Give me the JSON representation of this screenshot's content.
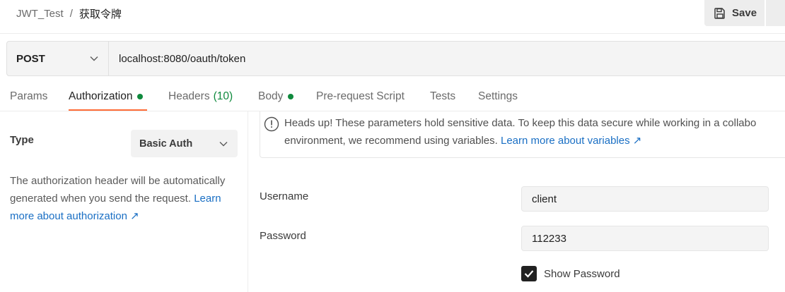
{
  "breadcrumb": {
    "collection": "JWT_Test",
    "separator": "/",
    "request": "获取令牌"
  },
  "toolbar": {
    "save_label": "Save"
  },
  "request": {
    "method": "POST",
    "url": "localhost:8080/oauth/token"
  },
  "tabs": [
    {
      "label": "Params"
    },
    {
      "label": "Authorization",
      "active": true,
      "dot": true
    },
    {
      "label": "Headers",
      "count": "(10)"
    },
    {
      "label": "Body",
      "dot": true
    },
    {
      "label": "Pre-request Script"
    },
    {
      "label": "Tests"
    },
    {
      "label": "Settings"
    }
  ],
  "auth": {
    "type_label": "Type",
    "type_value": "Basic Auth",
    "description": "The authorization header will be automatically generated when you send the request.",
    "learn_more": "Learn more about authorization ↗"
  },
  "notice": {
    "text": "Heads up! These parameters hold sensitive data. To keep this data secure while working in a collabo",
    "text2": "environment, we recommend using variables.",
    "link": "Learn more about variables ↗"
  },
  "fields": {
    "username_label": "Username",
    "username_value": "client",
    "password_label": "Password",
    "password_value": "112233",
    "show_password_label": "Show Password",
    "show_password_checked": true
  },
  "colors": {
    "accent": "#ff6c37",
    "dot": "#0f8a3d",
    "link": "#1a6fc4"
  },
  "icons": [
    "save-icon",
    "chevron-down-icon",
    "info-icon",
    "checkmark-icon"
  ]
}
